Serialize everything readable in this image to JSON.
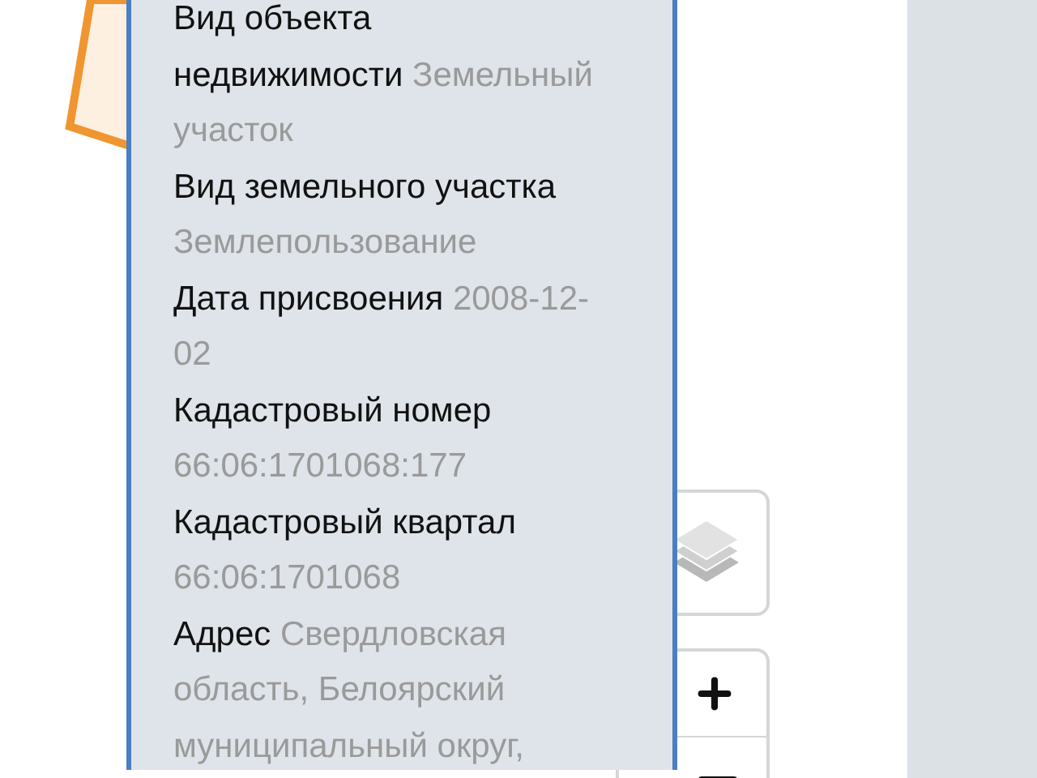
{
  "popup": {
    "fields": [
      {
        "label": "Вид объекта недвижимости",
        "value": "Земельный участок"
      },
      {
        "label": "Вид земельного участка",
        "value": "Землепользование"
      },
      {
        "label": "Дата присвоения",
        "value": "2008-12-02"
      },
      {
        "label": "Кадастровый номер",
        "value": "66:06:1701068:177"
      },
      {
        "label": "Кадастровый квартал",
        "value": "66:06:1701068"
      },
      {
        "label": "Адрес",
        "value": "Свердловская область, Белоярский муниципальный округ,"
      }
    ]
  }
}
